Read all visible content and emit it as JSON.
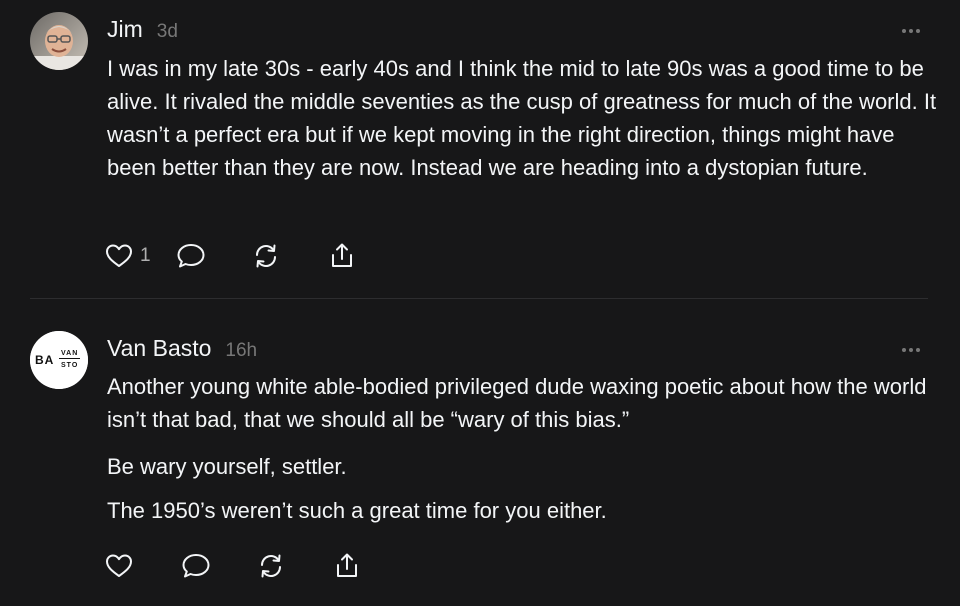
{
  "posts": [
    {
      "author": "Jim",
      "time": "3d",
      "paragraphs": [
        "I was in my late 30s - early 40s and I think the mid to late 90s was a good time to be alive. It rivaled the middle seventies as the cusp of greatness for much of the world. It wasn’t a perfect era but if we kept moving in the right direction, things might have been better than they are now. Instead we are heading into a dystopian future."
      ],
      "like_count": "1",
      "avatar": "photo-avatar"
    },
    {
      "author": "Van Basto",
      "time": "16h",
      "paragraphs": [
        "Another young white able-bodied privileged dude waxing poetic about how the world isn’t that bad, that we should all be “wary of this bias.”",
        "Be wary yourself, settler.",
        "The 1950’s weren’t such a great time for you either."
      ],
      "like_count": "",
      "avatar_text": {
        "line1_left": "BA",
        "line1_right": "VAN",
        "line2_right": "STO"
      }
    }
  ],
  "icons": {
    "like": "heart-icon",
    "reply": "comment-bubble-icon",
    "repost": "repost-icon",
    "share": "share-icon",
    "more": "more-dots-icon"
  },
  "colors": {
    "background": "#171718",
    "text": "#f3f5f7",
    "secondary": "#777777",
    "icon": "#f3f5f7",
    "divider": "#2d2d2f"
  }
}
